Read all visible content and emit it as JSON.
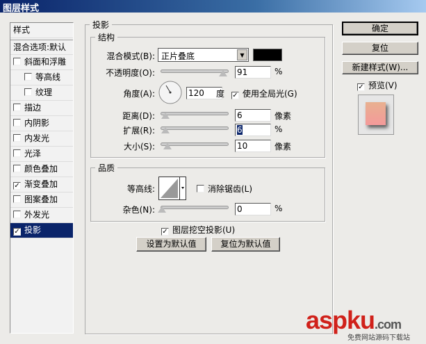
{
  "window": {
    "title": "图层样式"
  },
  "styles_panel": {
    "header": "样式",
    "blend_options": "混合选项:默认",
    "items": [
      {
        "label": "斜面和浮雕",
        "checked": false,
        "indent": false
      },
      {
        "label": "等高线",
        "checked": false,
        "indent": true
      },
      {
        "label": "纹理",
        "checked": false,
        "indent": true
      },
      {
        "label": "描边",
        "checked": false,
        "indent": false
      },
      {
        "label": "内阴影",
        "checked": false,
        "indent": false
      },
      {
        "label": "内发光",
        "checked": false,
        "indent": false
      },
      {
        "label": "光泽",
        "checked": false,
        "indent": false
      },
      {
        "label": "颜色叠加",
        "checked": false,
        "indent": false
      },
      {
        "label": "渐变叠加",
        "checked": true,
        "indent": false
      },
      {
        "label": "图案叠加",
        "checked": false,
        "indent": false
      },
      {
        "label": "外发光",
        "checked": false,
        "indent": false
      },
      {
        "label": "投影",
        "checked": true,
        "indent": false,
        "selected": true
      }
    ]
  },
  "drop_shadow": {
    "title": "投影",
    "structure": {
      "title": "结构",
      "blend_mode_label": "混合模式(B):",
      "blend_mode": "正片叠底",
      "shadow_color": "#000000",
      "opacity_label": "不透明度(O):",
      "opacity": "91",
      "opacity_unit": "%",
      "angle_label": "角度(A):",
      "angle": "120",
      "angle_unit": "度",
      "global_light_label": "使用全局光(G)",
      "global_light": true,
      "distance_label": "距离(D):",
      "distance": "6",
      "distance_unit": "像素",
      "spread_label": "扩展(R):",
      "spread": "6",
      "spread_unit": "%",
      "size_label": "大小(S):",
      "size": "10",
      "size_unit": "像素"
    },
    "quality": {
      "title": "品质",
      "contour_label": "等高线:",
      "anti_alias_label": "消除锯齿(L)",
      "anti_alias": false,
      "noise_label": "杂色(N):",
      "noise": "0",
      "noise_unit": "%"
    },
    "knockout_label": "图层挖空投影(U)",
    "knockout": true,
    "make_default": "设置为默认值",
    "reset_default": "复位为默认值"
  },
  "buttons": {
    "ok": "确定",
    "reset": "复位",
    "new_style": "新建样式(W)...",
    "preview_label": "预览(V)",
    "preview": true
  },
  "watermark": {
    "brand": "aspku",
    "tld": ".com",
    "subtitle": "免费网站源码下载站"
  }
}
